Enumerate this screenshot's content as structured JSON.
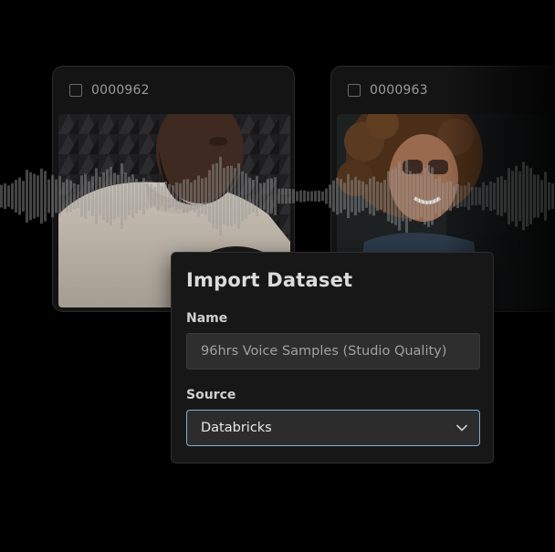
{
  "cards": [
    {
      "id": "0000962"
    },
    {
      "id": "0000963"
    }
  ],
  "dialog": {
    "title": "Import Dataset",
    "name_label": "Name",
    "name_value": "96hrs Voice Samples (Studio Quality)",
    "source_label": "Source",
    "source_value": "Databricks"
  },
  "colors": {
    "background": "#000000",
    "dialog_bg": "#171717",
    "input_bg": "#2e2e2e",
    "focus_border": "#7fb0d8"
  },
  "icons": [
    "checkbox-icon",
    "chevron-down-icon",
    "waveform-graphic"
  ]
}
